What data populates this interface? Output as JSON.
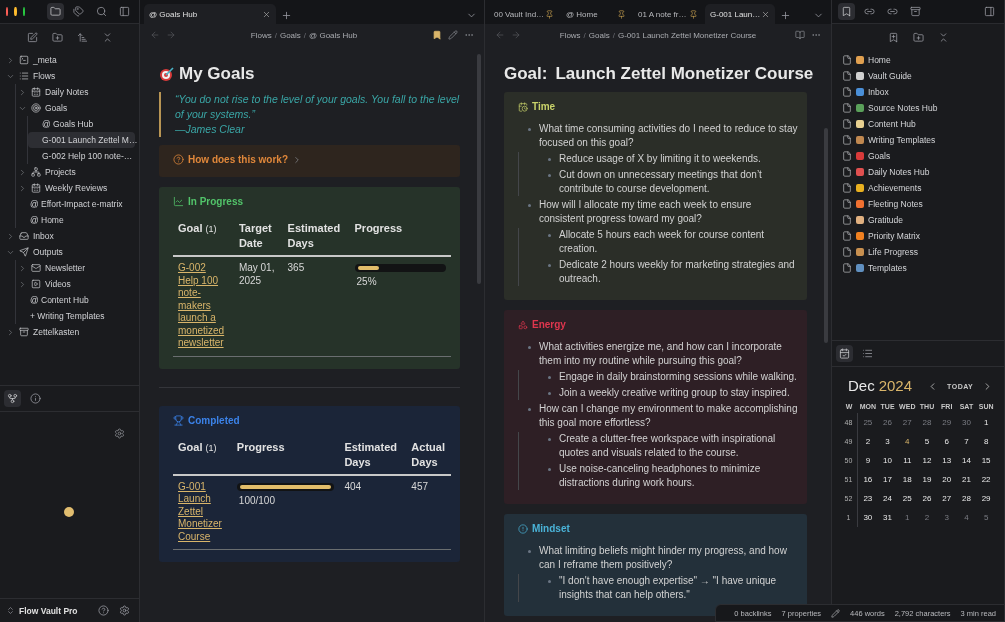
{
  "left_sidebar": {
    "tree": [
      {
        "label": "_meta",
        "expanded": false,
        "selected": false
      },
      {
        "label": "Flows",
        "expanded": true,
        "selected": false,
        "children": [
          {
            "label": "Daily Notes",
            "expanded": false,
            "selected": false
          },
          {
            "label": "Goals",
            "expanded": true,
            "selected": false,
            "children": [
              {
                "label": "@ Goals Hub",
                "selected": false
              },
              {
                "label": "G-001 Launch Zettel M…",
                "selected": true
              },
              {
                "label": "G-002 Help 100 note-…",
                "selected": false
              }
            ]
          },
          {
            "label": "Projects",
            "expanded": false,
            "selected": false
          },
          {
            "label": "Weekly Reviews",
            "expanded": false,
            "selected": false
          },
          {
            "label": "@ Effort-Impact e-matrix",
            "selected": false
          },
          {
            "label": "@ Home",
            "selected": false
          }
        ]
      },
      {
        "label": "Inbox",
        "expanded": false,
        "selected": false
      },
      {
        "label": "Outputs",
        "expanded": true,
        "selected": false,
        "children": [
          {
            "label": "Newsletter",
            "expanded": false,
            "selected": false
          },
          {
            "label": "Videos",
            "expanded": false,
            "selected": false
          },
          {
            "label": "@ Content Hub",
            "selected": false
          },
          {
            "label": "+ Writing Templates",
            "selected": false
          }
        ]
      },
      {
        "label": "Zettelkasten",
        "expanded": false,
        "selected": false
      }
    ],
    "vault_name": "Flow Vault Pro"
  },
  "left_pane": {
    "tabs": [
      {
        "label": "@ Goals Hub",
        "selected": true
      }
    ],
    "breadcrumb": [
      "Flows",
      "Goals",
      "@ Goals Hub"
    ],
    "breadcrumb_separator": "/",
    "bookmarked": true,
    "title": "My Goals",
    "quote": {
      "text": "“You do not rise to the level of your goals. You fall to the level of your systems.”",
      "author": "—James Clear"
    },
    "blocks": [
      {
        "kind": "help",
        "title": "How does this work?",
        "collapsed": true
      },
      {
        "kind": "progress",
        "title": "In Progress",
        "table": {
          "columns": [
            {
              "label": "Goal",
              "count": "(1)"
            },
            {
              "label": "Target Date"
            },
            {
              "label": "Estimated Days"
            },
            {
              "label": "Progress"
            }
          ],
          "rows": [
            [
              {
                "kind": "link",
                "text": "G-002 Help 100 note-makers launch a monetized newsletter"
              },
              {
                "kind": "text",
                "text": "May 01, 2025"
              },
              {
                "kind": "text",
                "text": "365"
              },
              {
                "kind": "bar",
                "level": 0.25,
                "text": "25%"
              }
            ]
          ]
        }
      },
      {
        "kind": "divider"
      },
      {
        "kind": "completed",
        "title": "Completed",
        "table": {
          "columns": [
            {
              "label": "Goal",
              "count": "(1)"
            },
            {
              "label": "Progress"
            },
            {
              "label": "Estimated Days"
            },
            {
              "label": "Actual Days"
            }
          ],
          "rows": [
            [
              {
                "kind": "link",
                "text": "G-001 Launch Zettel Monetizer Course"
              },
              {
                "kind": "bar",
                "level": 1,
                "text": "100/100"
              },
              {
                "kind": "text",
                "text": "404"
              },
              {
                "kind": "text",
                "text": "457"
              }
            ]
          ]
        }
      }
    ]
  },
  "right_pane": {
    "tabs": [
      {
        "label": "00 Vault Ind…",
        "pinned": true,
        "selected": false
      },
      {
        "label": "@ Home",
        "pinned": true,
        "selected": false
      },
      {
        "label": "01 A note fr…",
        "pinned": true,
        "selected": false
      },
      {
        "label": "G-001 Laun…",
        "pinned": false,
        "selected": true
      }
    ],
    "breadcrumb": [
      "Flows",
      "Goals",
      "G-001 Launch Zettel Monetizer Course"
    ],
    "breadcrumb_separator": "/",
    "title": {
      "prefix": "Goal:",
      "text": "Launch Zettel Monetizer Course"
    },
    "sections": [
      {
        "kind": "time",
        "title": "Time",
        "items": [
          {
            "text": "What time consuming activities do I need to reduce to stay focused on this goal?",
            "children": [
              {
                "text": "Reduce usage of X by limiting it to weekends."
              },
              {
                "text": "Cut down on unnecessary meetings that don’t contribute to course development."
              }
            ]
          },
          {
            "text": "How will I allocate my time each week to ensure consistent progress toward my goal?",
            "children": [
              {
                "text": "Allocate 5 hours each week for course content creation."
              },
              {
                "text": "Dedicate 2 hours weekly for marketing strategies and outreach."
              }
            ]
          }
        ]
      },
      {
        "kind": "energy",
        "title": "Energy",
        "items": [
          {
            "text": "What activities energize me, and how can I incorporate them into my routine while pursuing this goal?",
            "children": [
              {
                "text": "Engage in daily brainstorming sessions while walking."
              },
              {
                "text": "Join a weekly creative writing group to stay inspired."
              }
            ]
          },
          {
            "text": "How can I change my environment to make accomplishing this goal more effortless?",
            "children": [
              {
                "text": "Create a clutter-free workspace with inspirational quotes and visuals related to the course."
              },
              {
                "text": "Use noise-canceling headphones to minimize distractions during work hours."
              }
            ]
          }
        ]
      },
      {
        "kind": "mindset",
        "title": "Mindset",
        "items": [
          {
            "text": "What limiting beliefs might hinder my progress, and how can I reframe them positively?",
            "children": [
              {
                "text": "\"I don't have enough expertise\" → \"I have unique insights that can help others.\""
              }
            ]
          }
        ]
      }
    ]
  },
  "right_sidebar": {
    "bookmarks": [
      {
        "label": "Home",
        "color": "#e0a050"
      },
      {
        "label": "Vault Guide",
        "color": "#d0d0d0"
      },
      {
        "label": "Inbox",
        "color": "#4a8fd8"
      },
      {
        "label": "Source Notes Hub",
        "color": "#5aa05a"
      },
      {
        "label": "Content Hub",
        "color": "#e8d090"
      },
      {
        "label": "Writing Templates",
        "color": "#c08850"
      },
      {
        "label": "Goals",
        "color": "#d83a3a"
      },
      {
        "label": "Daily Notes Hub",
        "color": "#e05050"
      },
      {
        "label": "Achievements",
        "color": "#e8b020"
      },
      {
        "label": "Fleeting Notes",
        "color": "#f07030"
      },
      {
        "label": "Gratitude",
        "color": "#e0b080"
      },
      {
        "label": "Priority Matrix",
        "color": "#f08020"
      },
      {
        "label": "Life Progress",
        "color": "#c89050"
      },
      {
        "label": "Templates",
        "color": "#6090c0"
      }
    ],
    "calendar": {
      "month": "Dec",
      "year": "2024",
      "today_label": "TODAY",
      "headers": [
        "W",
        "MON",
        "TUE",
        "WED",
        "THU",
        "FRI",
        "SAT",
        "SUN"
      ],
      "weeks": [
        {
          "week": "48",
          "days": [
            {
              "day": "25",
              "muted": true,
              "today": false
            },
            {
              "day": "26",
              "muted": true,
              "today": false
            },
            {
              "day": "27",
              "muted": true,
              "today": false
            },
            {
              "day": "28",
              "muted": true,
              "today": false
            },
            {
              "day": "29",
              "muted": true,
              "today": false
            },
            {
              "day": "30",
              "muted": true,
              "today": false
            },
            {
              "day": "1",
              "muted": false,
              "today": false
            }
          ]
        },
        {
          "week": "49",
          "days": [
            {
              "day": "2",
              "muted": false,
              "today": false
            },
            {
              "day": "3",
              "muted": false,
              "today": false
            },
            {
              "day": "4",
              "muted": false,
              "today": true
            },
            {
              "day": "5",
              "muted": false,
              "today": false
            },
            {
              "day": "6",
              "muted": false,
              "today": false
            },
            {
              "day": "7",
              "muted": false,
              "today": false
            },
            {
              "day": "8",
              "muted": false,
              "today": false
            }
          ]
        },
        {
          "week": "50",
          "days": [
            {
              "day": "9",
              "muted": false,
              "today": false
            },
            {
              "day": "10",
              "muted": false,
              "today": false
            },
            {
              "day": "11",
              "muted": false,
              "today": false
            },
            {
              "day": "12",
              "muted": false,
              "today": false
            },
            {
              "day": "13",
              "muted": false,
              "today": false
            },
            {
              "day": "14",
              "muted": false,
              "today": false
            },
            {
              "day": "15",
              "muted": false,
              "today": false
            }
          ]
        },
        {
          "week": "51",
          "days": [
            {
              "day": "16",
              "muted": false,
              "today": false
            },
            {
              "day": "17",
              "muted": false,
              "today": false
            },
            {
              "day": "18",
              "muted": false,
              "today": false
            },
            {
              "day": "19",
              "muted": false,
              "today": false
            },
            {
              "day": "20",
              "muted": false,
              "today": false
            },
            {
              "day": "21",
              "muted": false,
              "today": false
            },
            {
              "day": "22",
              "muted": false,
              "today": false
            }
          ]
        },
        {
          "week": "52",
          "days": [
            {
              "day": "23",
              "muted": false,
              "today": false
            },
            {
              "day": "24",
              "muted": false,
              "today": false
            },
            {
              "day": "25",
              "muted": false,
              "today": false
            },
            {
              "day": "26",
              "muted": false,
              "today": false
            },
            {
              "day": "27",
              "muted": false,
              "today": false
            },
            {
              "day": "28",
              "muted": false,
              "today": false
            },
            {
              "day": "29",
              "muted": false,
              "today": false
            }
          ]
        },
        {
          "week": "1",
          "days": [
            {
              "day": "30",
              "muted": false,
              "today": false
            },
            {
              "day": "31",
              "muted": false,
              "today": false
            },
            {
              "day": "1",
              "muted": true,
              "today": false
            },
            {
              "day": "2",
              "muted": true,
              "today": false
            },
            {
              "day": "3",
              "muted": true,
              "today": false
            },
            {
              "day": "4",
              "muted": true,
              "today": false
            },
            {
              "day": "5",
              "muted": true,
              "today": false
            }
          ]
        }
      ]
    }
  },
  "status_bar": {
    "links": [
      "0 backlinks",
      "7 properties"
    ],
    "counts": [
      "446 words",
      "2,792 characters",
      "3 min read"
    ]
  }
}
